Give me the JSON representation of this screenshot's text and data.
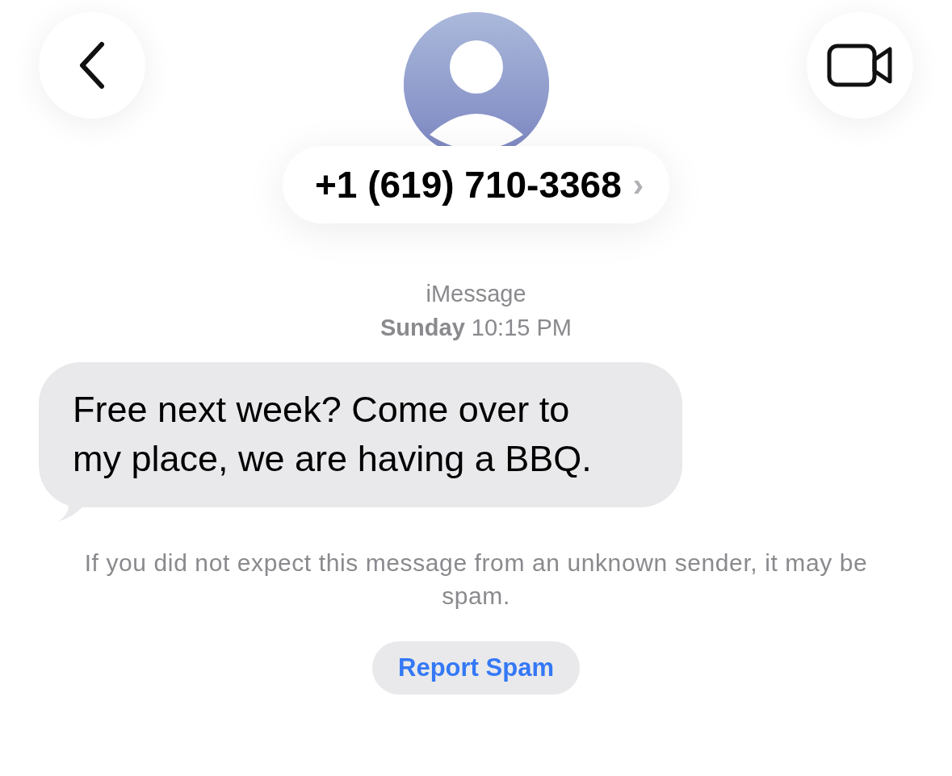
{
  "contact": {
    "name": "+1 (619) 710-3368",
    "chevron": "›"
  },
  "conversation": {
    "service": "iMessage",
    "timestamp": "**Sunday** 10:15 PM"
  },
  "messages": [
    {
      "text": "Free next week? Come over to my place, we are having a BBQ.",
      "incoming": true
    }
  ],
  "spam_notice": {
    "text": "If you did not expect this message from an unknown sender, it may be spam.",
    "button": "Report Spam"
  }
}
